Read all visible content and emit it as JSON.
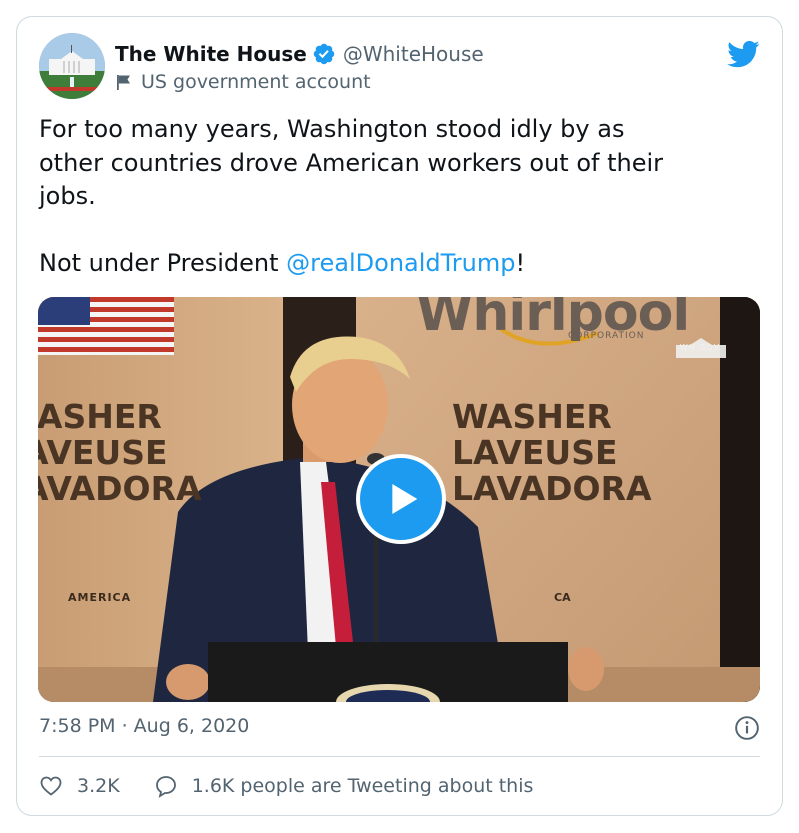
{
  "tweet": {
    "display_name": "The White House",
    "handle": "@WhiteHouse",
    "account_label": "US government account",
    "text_before_mention": "For too many years, Washington stood idly by as\nother countries drove American workers out of their\njobs.\n\nNot under President ",
    "mention": "@realDonaldTrump",
    "text_after_mention": "!",
    "timestamp": "7:58 PM · Aug 6, 2020",
    "likes": "3.2K",
    "tweeting_about": "1.6K people are Tweeting about this"
  },
  "video": {
    "brand": "Whirlpool",
    "brand_sub": "CORPORATION",
    "watermark": "WH.GOV",
    "box_left": "WASHER\nLAVEUSE\nLAVADORA",
    "box_right": "WASHER\nLAVEUSE\nLAVADORA",
    "box_origin_left": "AMERICA",
    "box_origin_right": "CA"
  },
  "icons": {
    "verified": "verified-badge-icon",
    "gov_flag": "flag-icon",
    "logo": "twitter-bird-icon",
    "play": "play-icon",
    "info": "info-icon",
    "like": "heart-icon",
    "reply": "speech-bubble-icon"
  },
  "colors": {
    "accent": "#1d9bf0",
    "text": "#0f1419",
    "muted": "#536471",
    "border": "#cfd9de"
  }
}
